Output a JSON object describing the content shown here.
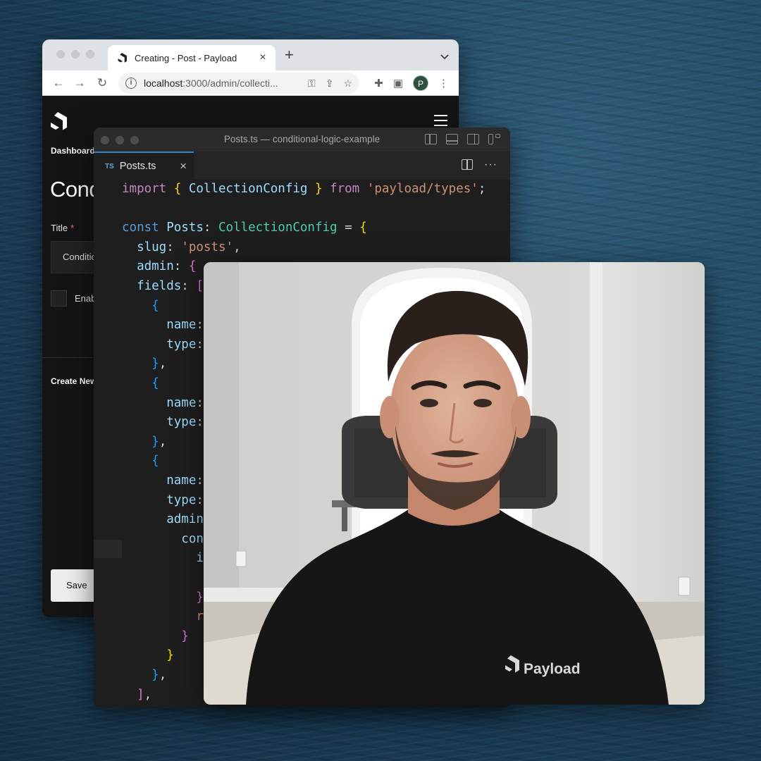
{
  "browser": {
    "tab_title": "Creating - Post - Payload",
    "url_host": "localhost",
    "url_path": ":3000/admin/collecti...",
    "profile_initial": "P",
    "breadcrumb": "Dashboard",
    "doc_title": "Conditional Logic Example",
    "title_label": "Title",
    "required_marker": "*",
    "title_value": "Conditional Logic Example",
    "checkbox_label": "Enable Call To Action",
    "create_new": "Create New",
    "save_label": "Save"
  },
  "editor": {
    "window_title": "Posts.ts — conditional-logic-example",
    "tab_badge": "TS",
    "tab_label": "Posts.ts"
  },
  "code_lines": [
    [
      [
        "kw",
        "import"
      ],
      [
        "p",
        " "
      ],
      [
        "b1",
        "{"
      ],
      [
        "p",
        " "
      ],
      [
        "var",
        "CollectionConfig"
      ],
      [
        "p",
        " "
      ],
      [
        "b1",
        "}"
      ],
      [
        "p",
        " "
      ],
      [
        "kw",
        "from"
      ],
      [
        "p",
        " "
      ],
      [
        "str",
        "'payload/types'"
      ],
      [
        "p",
        ";"
      ]
    ],
    [],
    [
      [
        "key",
        "const"
      ],
      [
        "p",
        " "
      ],
      [
        "var",
        "Posts"
      ],
      [
        "p",
        ": "
      ],
      [
        "type",
        "CollectionConfig"
      ],
      [
        "p",
        " = "
      ],
      [
        "b1",
        "{"
      ]
    ],
    [
      [
        "p",
        "  "
      ],
      [
        "prop",
        "slug"
      ],
      [
        "p",
        ": "
      ],
      [
        "str",
        "'posts'"
      ],
      [
        "p",
        ","
      ]
    ],
    [
      [
        "p",
        "  "
      ],
      [
        "prop",
        "admin"
      ],
      [
        "p",
        ": "
      ],
      [
        "b2",
        "{"
      ]
    ],
    [
      [
        "p",
        "  "
      ],
      [
        "prop",
        "fields"
      ],
      [
        "p",
        ": "
      ],
      [
        "b2",
        "["
      ]
    ],
    [
      [
        "p",
        "    "
      ],
      [
        "b3",
        "{"
      ]
    ],
    [
      [
        "p",
        "      "
      ],
      [
        "prop",
        "name"
      ],
      [
        "p",
        ":"
      ]
    ],
    [
      [
        "p",
        "      "
      ],
      [
        "prop",
        "type"
      ],
      [
        "p",
        ":"
      ]
    ],
    [
      [
        "p",
        "    "
      ],
      [
        "b3",
        "}"
      ],
      [
        "p",
        ","
      ]
    ],
    [
      [
        "p",
        "    "
      ],
      [
        "b3",
        "{"
      ]
    ],
    [
      [
        "p",
        "      "
      ],
      [
        "prop",
        "name"
      ],
      [
        "p",
        ":"
      ]
    ],
    [
      [
        "p",
        "      "
      ],
      [
        "prop",
        "type"
      ],
      [
        "p",
        ":"
      ]
    ],
    [
      [
        "p",
        "    "
      ],
      [
        "b3",
        "}"
      ],
      [
        "p",
        ","
      ]
    ],
    [
      [
        "p",
        "    "
      ],
      [
        "b3",
        "{"
      ]
    ],
    [
      [
        "p",
        "      "
      ],
      [
        "prop",
        "name"
      ],
      [
        "p",
        ":"
      ]
    ],
    [
      [
        "p",
        "      "
      ],
      [
        "prop",
        "type"
      ],
      [
        "p",
        ":"
      ]
    ],
    [
      [
        "p",
        "      "
      ],
      [
        "prop",
        "admin"
      ]
    ],
    [
      [
        "p",
        "        "
      ],
      [
        "var",
        "con"
      ]
    ],
    [
      [
        "p",
        "          "
      ],
      [
        "var",
        "i"
      ]
    ],
    [],
    [
      [
        "p",
        "          "
      ],
      [
        "b2",
        "}"
      ]
    ],
    [
      [
        "p",
        "          "
      ],
      [
        "str",
        "r"
      ]
    ],
    [
      [
        "p",
        "        "
      ],
      [
        "b2",
        "}"
      ]
    ],
    [
      [
        "p",
        "      "
      ],
      [
        "b1",
        "}"
      ]
    ],
    [
      [
        "p",
        "    "
      ],
      [
        "b3",
        "}"
      ],
      [
        "p",
        ","
      ]
    ],
    [
      [
        "p",
        "  "
      ],
      [
        "b2",
        "]"
      ],
      [
        "p",
        ","
      ]
    ]
  ],
  "webcam": {
    "shirt_logo_text": "Payload"
  }
}
